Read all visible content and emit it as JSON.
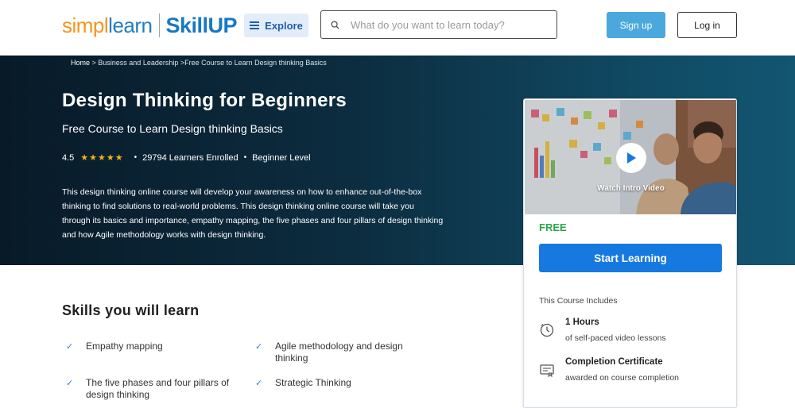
{
  "header": {
    "logo_left": "simplilearn",
    "logo_left_a": "simpl",
    "logo_left_b": "learn",
    "logo_right": "SkillUP",
    "explore_label": "Explore",
    "search_placeholder": "What do you want to learn today?",
    "signup_label": "Sign up",
    "login_label": "Log in"
  },
  "breadcrumb": {
    "home": "Home",
    "sep1": " > ",
    "category": "Business and Leadership",
    "sep2": " >",
    "current": "Free Course to Learn Design thinking Basics"
  },
  "course": {
    "title": "Design Thinking for Beginners",
    "subtitle": "Free Course to Learn Design thinking Basics",
    "rating": "4.5",
    "stars": 4.5,
    "stars_glyphs": "★★★★★",
    "learners": "29794 Learners Enrolled",
    "level": "Beginner Level",
    "description": "This design thinking online course will develop your awareness on how to enhance out-of-the-box thinking to find solutions to real-world problems. This design thinking online course will take you through its basics and importance, empathy mapping, the five phases and four pillars of design thinking and how Agile methodology works with design thinking."
  },
  "card": {
    "watch_label": "Watch Intro Video",
    "price": "FREE",
    "cta_label": "Start Learning",
    "includes_label": "This Course Includes",
    "includes": [
      {
        "title": "1 Hours",
        "subtitle": "of self-paced video lessons",
        "icon": "clock-icon"
      },
      {
        "title": "Completion Certificate",
        "subtitle": "awarded on course completion",
        "icon": "certificate-icon"
      }
    ]
  },
  "skills": {
    "title": "Skills you will learn",
    "items": [
      "Empathy mapping",
      "Agile methodology and design thinking",
      "The five phases and four pillars of design thinking",
      "Strategic Thinking"
    ]
  },
  "colors": {
    "brand_orange": "#f7941d",
    "brand_blue": "#1679c5",
    "cta_blue": "#1679e0",
    "free_green": "#2ca44f",
    "star_gold": "#f5b21a",
    "hero_dark": "#081a28"
  }
}
